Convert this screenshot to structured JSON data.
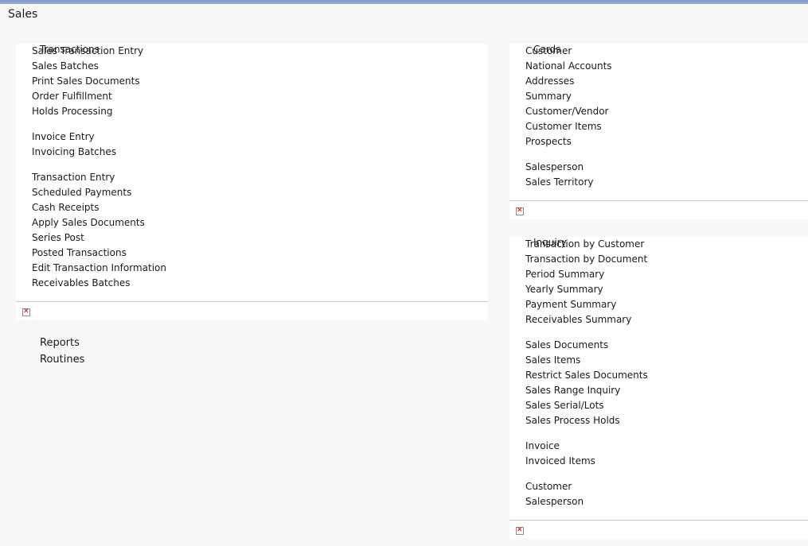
{
  "page": {
    "title": "Sales"
  },
  "transactions": {
    "header": "Transactions",
    "items": [
      "Sales Transaction Entry",
      "Sales Batches",
      "Print Sales Documents",
      "Order Fulfillment",
      "Holds Processing",
      "Invoice Entry",
      "Invoicing Batches",
      "Transaction Entry",
      "Scheduled Payments",
      "Cash Receipts",
      "Apply Sales Documents",
      "Series Post",
      "Posted Transactions",
      "Edit Transaction Information",
      "Receivables Batches"
    ]
  },
  "cards": {
    "header": "Cards",
    "items": [
      "Customer",
      "National Accounts",
      "Addresses",
      "Summary",
      "Customer/Vendor",
      "Customer Items",
      "Prospects",
      "Salesperson",
      "Sales Territory"
    ]
  },
  "inquiry": {
    "header": "Inquiry",
    "items": [
      "Transaction by Customer",
      "Transaction by Document",
      "Period Summary",
      "Yearly Summary",
      "Payment Summary",
      "Receivables Summary",
      "Sales Documents",
      "Sales Items",
      "Restrict Sales Documents",
      "Sales Range Inquiry",
      "Sales Serial/Lots",
      "Sales Process Holds",
      "Invoice",
      "Invoiced Items",
      "Customer",
      "Salesperson"
    ]
  },
  "links": {
    "reports": "Reports",
    "routines": "Routines"
  },
  "icons": {
    "broken_image": "broken-image-icon"
  },
  "colors": {
    "broken_image_x": "#cc0000"
  }
}
